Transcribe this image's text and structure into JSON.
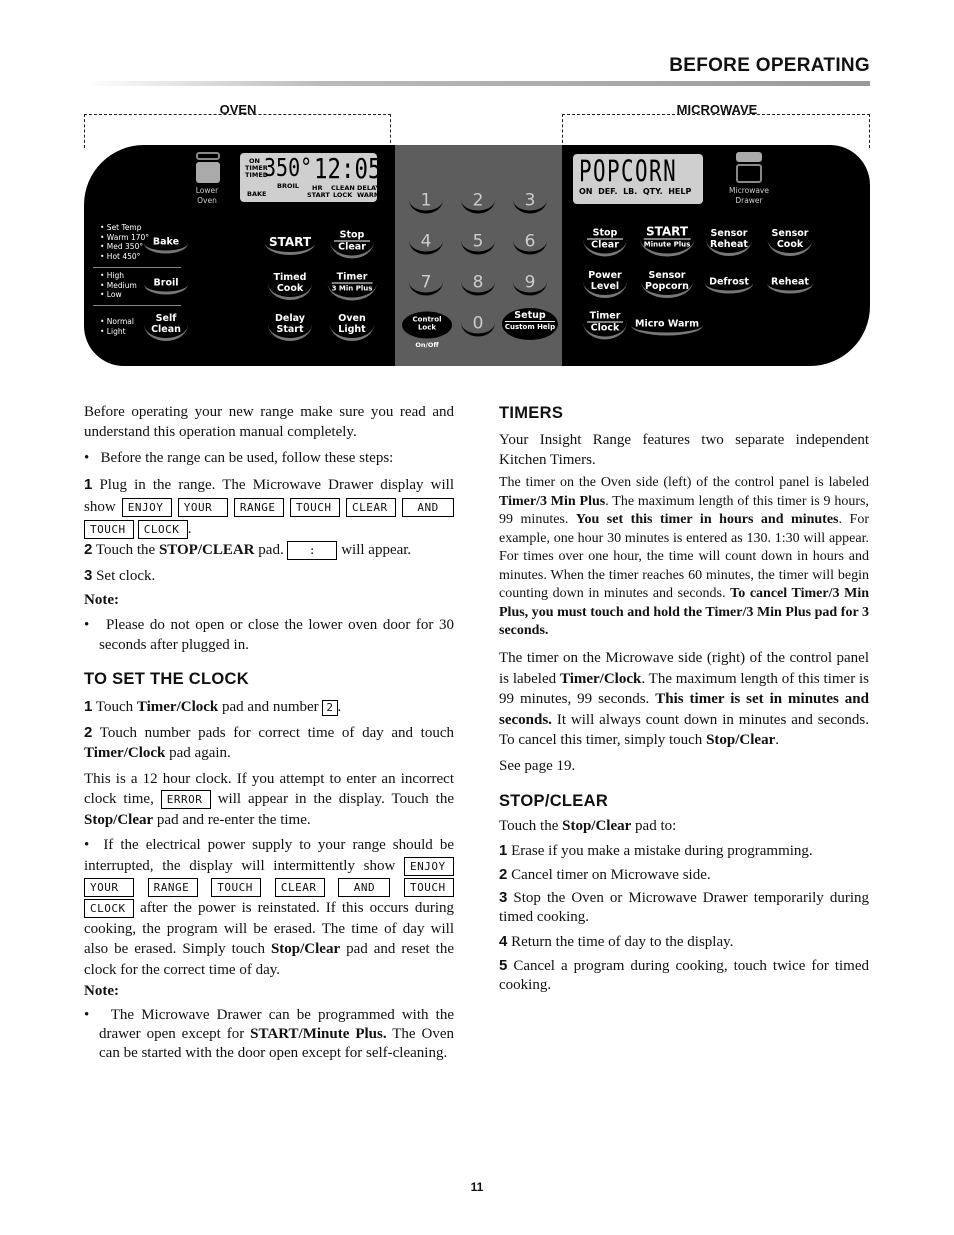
{
  "header": {
    "title": "BEFORE OPERATING"
  },
  "panel": {
    "oven_label": "OVEN",
    "microwave_label": "MICROWAVE",
    "oven": {
      "indicator": [
        "Lower",
        "Oven"
      ],
      "lcd": {
        "on": "ON",
        "timer": "TIMER",
        "timed": "TIMED",
        "temp": "350°",
        "time": "12:05",
        "bake": "BAKE",
        "broil": "BROIL",
        "hr": "HR",
        "start": "START",
        "clean": "CLEAN",
        "lock": "LOCK",
        "delay": "DELAY",
        "warm": "WARM"
      },
      "bake_options": [
        "• Set Temp",
        "• Warm 170°",
        "• Med 350°",
        "• Hot 450°"
      ],
      "broil_options": [
        "• High",
        "• Medium",
        "• Low"
      ],
      "clean_options": [
        "• Normal",
        "• Light"
      ],
      "pads": {
        "bake": "Bake",
        "broil": "Broil",
        "self_clean": [
          "Self",
          "Clean"
        ],
        "start": "START",
        "stop_clear": [
          "Stop",
          "Clear"
        ],
        "timed_cook": [
          "Timed",
          "Cook"
        ],
        "timer": [
          "Timer",
          "3 Min Plus"
        ],
        "delay_start": [
          "Delay",
          "Start"
        ],
        "oven_light": [
          "Oven",
          "Light"
        ]
      }
    },
    "keypad": {
      "digits": [
        "1",
        "2",
        "3",
        "4",
        "5",
        "6",
        "7",
        "8",
        "9",
        "0"
      ],
      "control_lock": [
        "Control",
        "Lock"
      ],
      "on_off": "On/Off",
      "setup": [
        "Setup",
        "Custom Help"
      ]
    },
    "microwave": {
      "lcd": {
        "text": "POPCORN",
        "indicators": "ON  DEF.  LB.  QTY.  HELP"
      },
      "indicator": [
        "Microwave",
        "Drawer"
      ],
      "pads": {
        "stop_clear": [
          "Stop",
          "Clear"
        ],
        "start": [
          "START",
          "Minute Plus"
        ],
        "sensor_reheat": [
          "Sensor",
          "Reheat"
        ],
        "sensor_cook": [
          "Sensor",
          "Cook"
        ],
        "power_level": [
          "Power",
          "Level"
        ],
        "sensor_popcorn": [
          "Sensor",
          "Popcorn"
        ],
        "defrost": "Defrost",
        "reheat": "Reheat",
        "timer_clock": [
          "Timer",
          "Clock"
        ],
        "micro_warm": "Micro Warm"
      }
    },
    "colors": {
      "panel": "#000000",
      "keypad": "#5d5d5d",
      "lcd": "#cfcfcf"
    }
  },
  "left": {
    "intro": "Before operating your new range make sure you read and understand this operation manual completely.",
    "bullet1": "Before the range can be used, follow these steps:",
    "step1_num": "1",
    "step1_a": "Plug in the range. The Microwave Drawer display will show",
    "display_words": [
      "ENJOY",
      "YOUR",
      "RANGE",
      "TOUCH",
      "CLEAR",
      "AND",
      "TOUCH",
      "CLOCK"
    ],
    "step2_num": "2",
    "step2_a": "Touch the",
    "step2_b": "STOP/CLEAR",
    "step2_c": "pad.",
    "step2_box": ":",
    "step2_d": "will appear.",
    "step3_num": "3",
    "step3_a": "Set clock.",
    "note1": "Note:",
    "note1_bullet": "Please do not open or close the lower oven door for 30 seconds after plugged in.",
    "clock_heading": "TO SET THE CLOCK",
    "c1_num": "1",
    "c1_a": "Touch",
    "c1_b": "Timer/Clock",
    "c1_c": "pad and number",
    "c1_box": "2",
    "c2_num": "2",
    "c2_a": "Touch number pads for correct time of day and touch",
    "c2_b": "Timer/Clock",
    "c2_c": "pad again.",
    "c3_a": "This is a 12 hour clock. If you attempt to enter an incorrect clock time,",
    "c3_box": "ERROR",
    "c3_b": "will appear in the display. Touch the",
    "c3_c": "Stop/Clear",
    "c3_d": "pad and re-enter the time.",
    "c4_a": "If the electrical power supply to your range should be interrupted, the display will intermittently show",
    "c4_b": "after the power is reinstated. If this occurs during cooking, the program will be erased. The time of day will also be erased. Simply touch",
    "c4_c": "Stop/Clear",
    "c4_d": "pad and reset the clock for the correct time of day.",
    "note2": "Note:",
    "note2_a": "The Microwave Drawer can be programmed with the drawer open except for",
    "note2_b": "START/Minute Plus.",
    "note2_c": "The Oven can be started with the door open except for self-cleaning."
  },
  "right": {
    "timers_heading": "TIMERS",
    "t1": "Your Insight Range features two separate independent Kitchen Timers.",
    "t2_a": "The timer on the Oven side (left) of the control panel is labeled",
    "t2_b": "Timer/3 Min Plus",
    "t2_c": ". The maximum length of this timer is 9 hours, 99 minutes.",
    "t2_d": "You set this timer in hours and minutes",
    "t2_e": ". For example, one hour 30 minutes is entered as 130. 1:30 will appear. For times over one hour, the time will count down in hours and minutes. When the timer reaches 60 minutes, the timer will begin counting down in minutes and seconds.",
    "t2_f": "To cancel Timer/3 Min Plus, you must touch and hold the Timer/3 Min Plus pad for 3 seconds.",
    "t3_a": "The timer on the Microwave side (right) of the control panel is labeled",
    "t3_b": "Timer/Clock",
    "t3_c": ". The maximum length of this timer is 99 minutes, 99 seconds.",
    "t3_d": "This timer is set in minutes and seconds.",
    "t3_e": "It will always count down in minutes and seconds. To cancel this timer, simply touch",
    "t3_f": "Stop/Clear",
    "t3_g": ".",
    "see": "See page 19.",
    "stop_heading": "STOP/CLEAR",
    "s_a": "Touch the",
    "s_b": "Stop/Clear",
    "s_c": "pad to:",
    "items": [
      {
        "num": "1",
        "text": "Erase if you make a mistake during programming."
      },
      {
        "num": "2",
        "text": "Cancel timer on Microwave side."
      },
      {
        "num": "3",
        "text": "Stop the Oven or Microwave Drawer temporarily during timed cooking."
      },
      {
        "num": "4",
        "text": "Return the time of day to the display."
      },
      {
        "num": "5",
        "text": "Cancel a program during cooking, touch twice for timed cooking."
      }
    ]
  },
  "footer": {
    "page_number": "11"
  }
}
